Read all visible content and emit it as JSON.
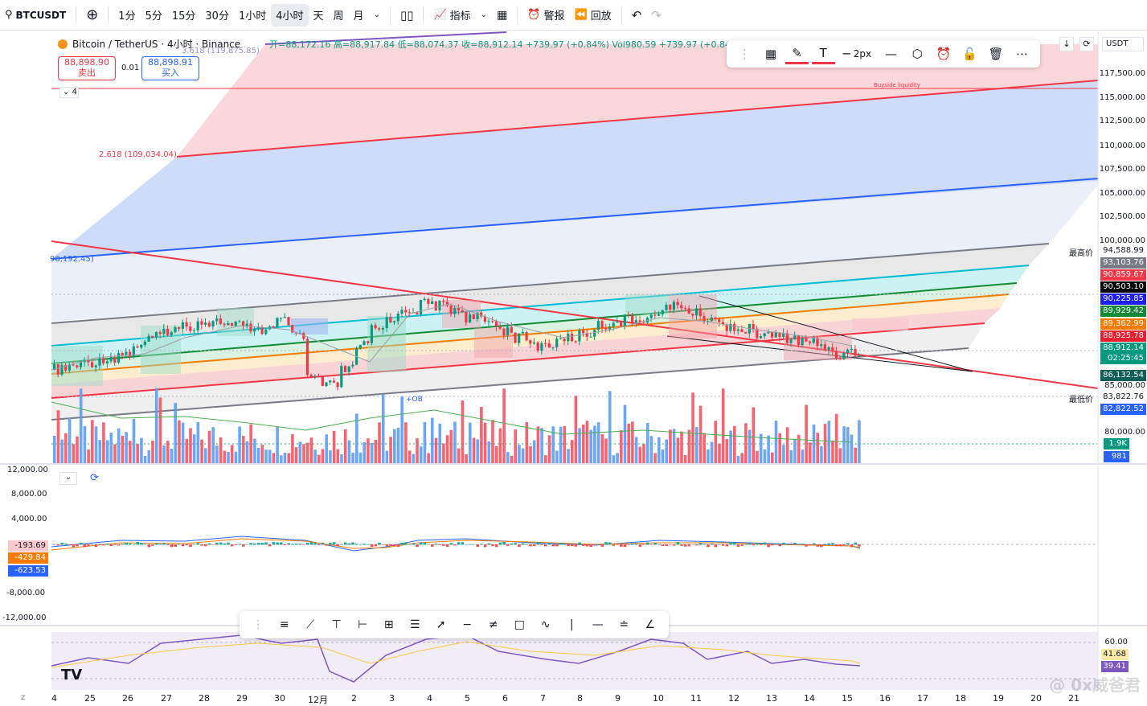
{
  "header": {
    "symbol": "BTCUSDT",
    "timeframes": [
      "1分",
      "5分",
      "15分",
      "30分",
      "1小时",
      "4小时",
      "天",
      "周",
      "月"
    ],
    "active_timeframe": "4小时",
    "indicators_label": "指标",
    "alert_label": "警报",
    "replay_label": "回放"
  },
  "legend": {
    "title": "Bitcoin / TetherUS · 4小时 · Binance",
    "ohlc": "开=88,172.16 高=88,917.84 低=88,074.37 收=88,912.14 +739.97 (+0.84%) Vol980.59 +739.97 (+0.84"
  },
  "trade": {
    "sell_price": "88,898.90",
    "sell_label": "卖出",
    "spread": "0.01",
    "buy_price": "88,898.91",
    "buy_label": "买入"
  },
  "collapse_count": "4",
  "drawing_toolbar": {
    "width_label": "2px"
  },
  "annotations": {
    "fib_2618": "2.618 (109,034.04)",
    "fib_left": "98,192.45)",
    "fib_top": "3.618 (119,875.85)",
    "buyside": "Buyside liquidity",
    "ob": "+OB"
  },
  "price_axis": {
    "currency": "USDT",
    "ticks": [
      "117,500.00",
      "115,000.00",
      "112,500.00",
      "110,000.00",
      "107,500.00",
      "105,000.00",
      "102,500.00",
      "100,000.00",
      "85,000.00",
      "80,000.00"
    ],
    "tags": [
      {
        "value": "94,588.99",
        "color": "#ffffff",
        "text": "#131722"
      },
      {
        "value": "93,103.76",
        "color": "#787b86",
        "text": "#ffffff"
      },
      {
        "value": "90,859.67",
        "color": "#f23645",
        "text": "#ffffff"
      },
      {
        "value": "90,503.10",
        "color": "#000000",
        "text": "#ffffff"
      },
      {
        "value": "90,225.85",
        "color": "#1e1ef0",
        "text": "#ffffff"
      },
      {
        "value": "89,929.42",
        "color": "#138a36",
        "text": "#ffffff"
      },
      {
        "value": "89,362.99",
        "color": "#f57c00",
        "text": "#ffffff"
      },
      {
        "value": "88,925.78",
        "color": "#e91e2e",
        "text": "#ffffff"
      },
      {
        "value": "88,912.14",
        "color": "#089981",
        "text": "#ffffff"
      },
      {
        "value": "02:25:45",
        "color": "#089981",
        "text": "#ffffff"
      },
      {
        "value": "86,132.54",
        "color": "#0f5e58",
        "text": "#ffffff"
      },
      {
        "value": "83,822.76",
        "color": "#ffffff",
        "text": "#131722"
      },
      {
        "value": "82,822.52",
        "color": "#2962ff",
        "text": "#ffffff"
      },
      {
        "value": "1.9K",
        "color": "#089981",
        "text": "#ffffff"
      },
      {
        "value": "981",
        "color": "#2962ff",
        "text": "#ffffff"
      }
    ],
    "high_label": "最高价",
    "low_label": "最低价"
  },
  "macd": {
    "ticks": [
      "12,000.00",
      "8,000.00",
      "4,000.00",
      "-8,000.00",
      "-12,000.00"
    ],
    "tags": [
      {
        "value": "-193.69",
        "color": "#f8c9cd",
        "text": "#131722"
      },
      {
        "value": "-429.84",
        "color": "#f57c00",
        "text": "#ffffff"
      },
      {
        "value": "-623.53",
        "color": "#2962ff",
        "text": "#ffffff"
      }
    ]
  },
  "rsi": {
    "ticks": [
      "60.00"
    ],
    "tags": [
      {
        "value": "41.68",
        "color": "#fbe9a8",
        "text": "#131722"
      },
      {
        "value": "39.41",
        "color": "#7e57c2",
        "text": "#ffffff"
      }
    ]
  },
  "dates": [
    "4",
    "25",
    "26",
    "27",
    "28",
    "29",
    "30",
    "12月",
    "2",
    "3",
    "4",
    "5",
    "6",
    "7",
    "8",
    "9",
    "10",
    "11",
    "12",
    "13",
    "14",
    "15",
    "16",
    "17",
    "18",
    "19",
    "20",
    "21"
  ],
  "watermark": "@ 0x威爸君"
}
